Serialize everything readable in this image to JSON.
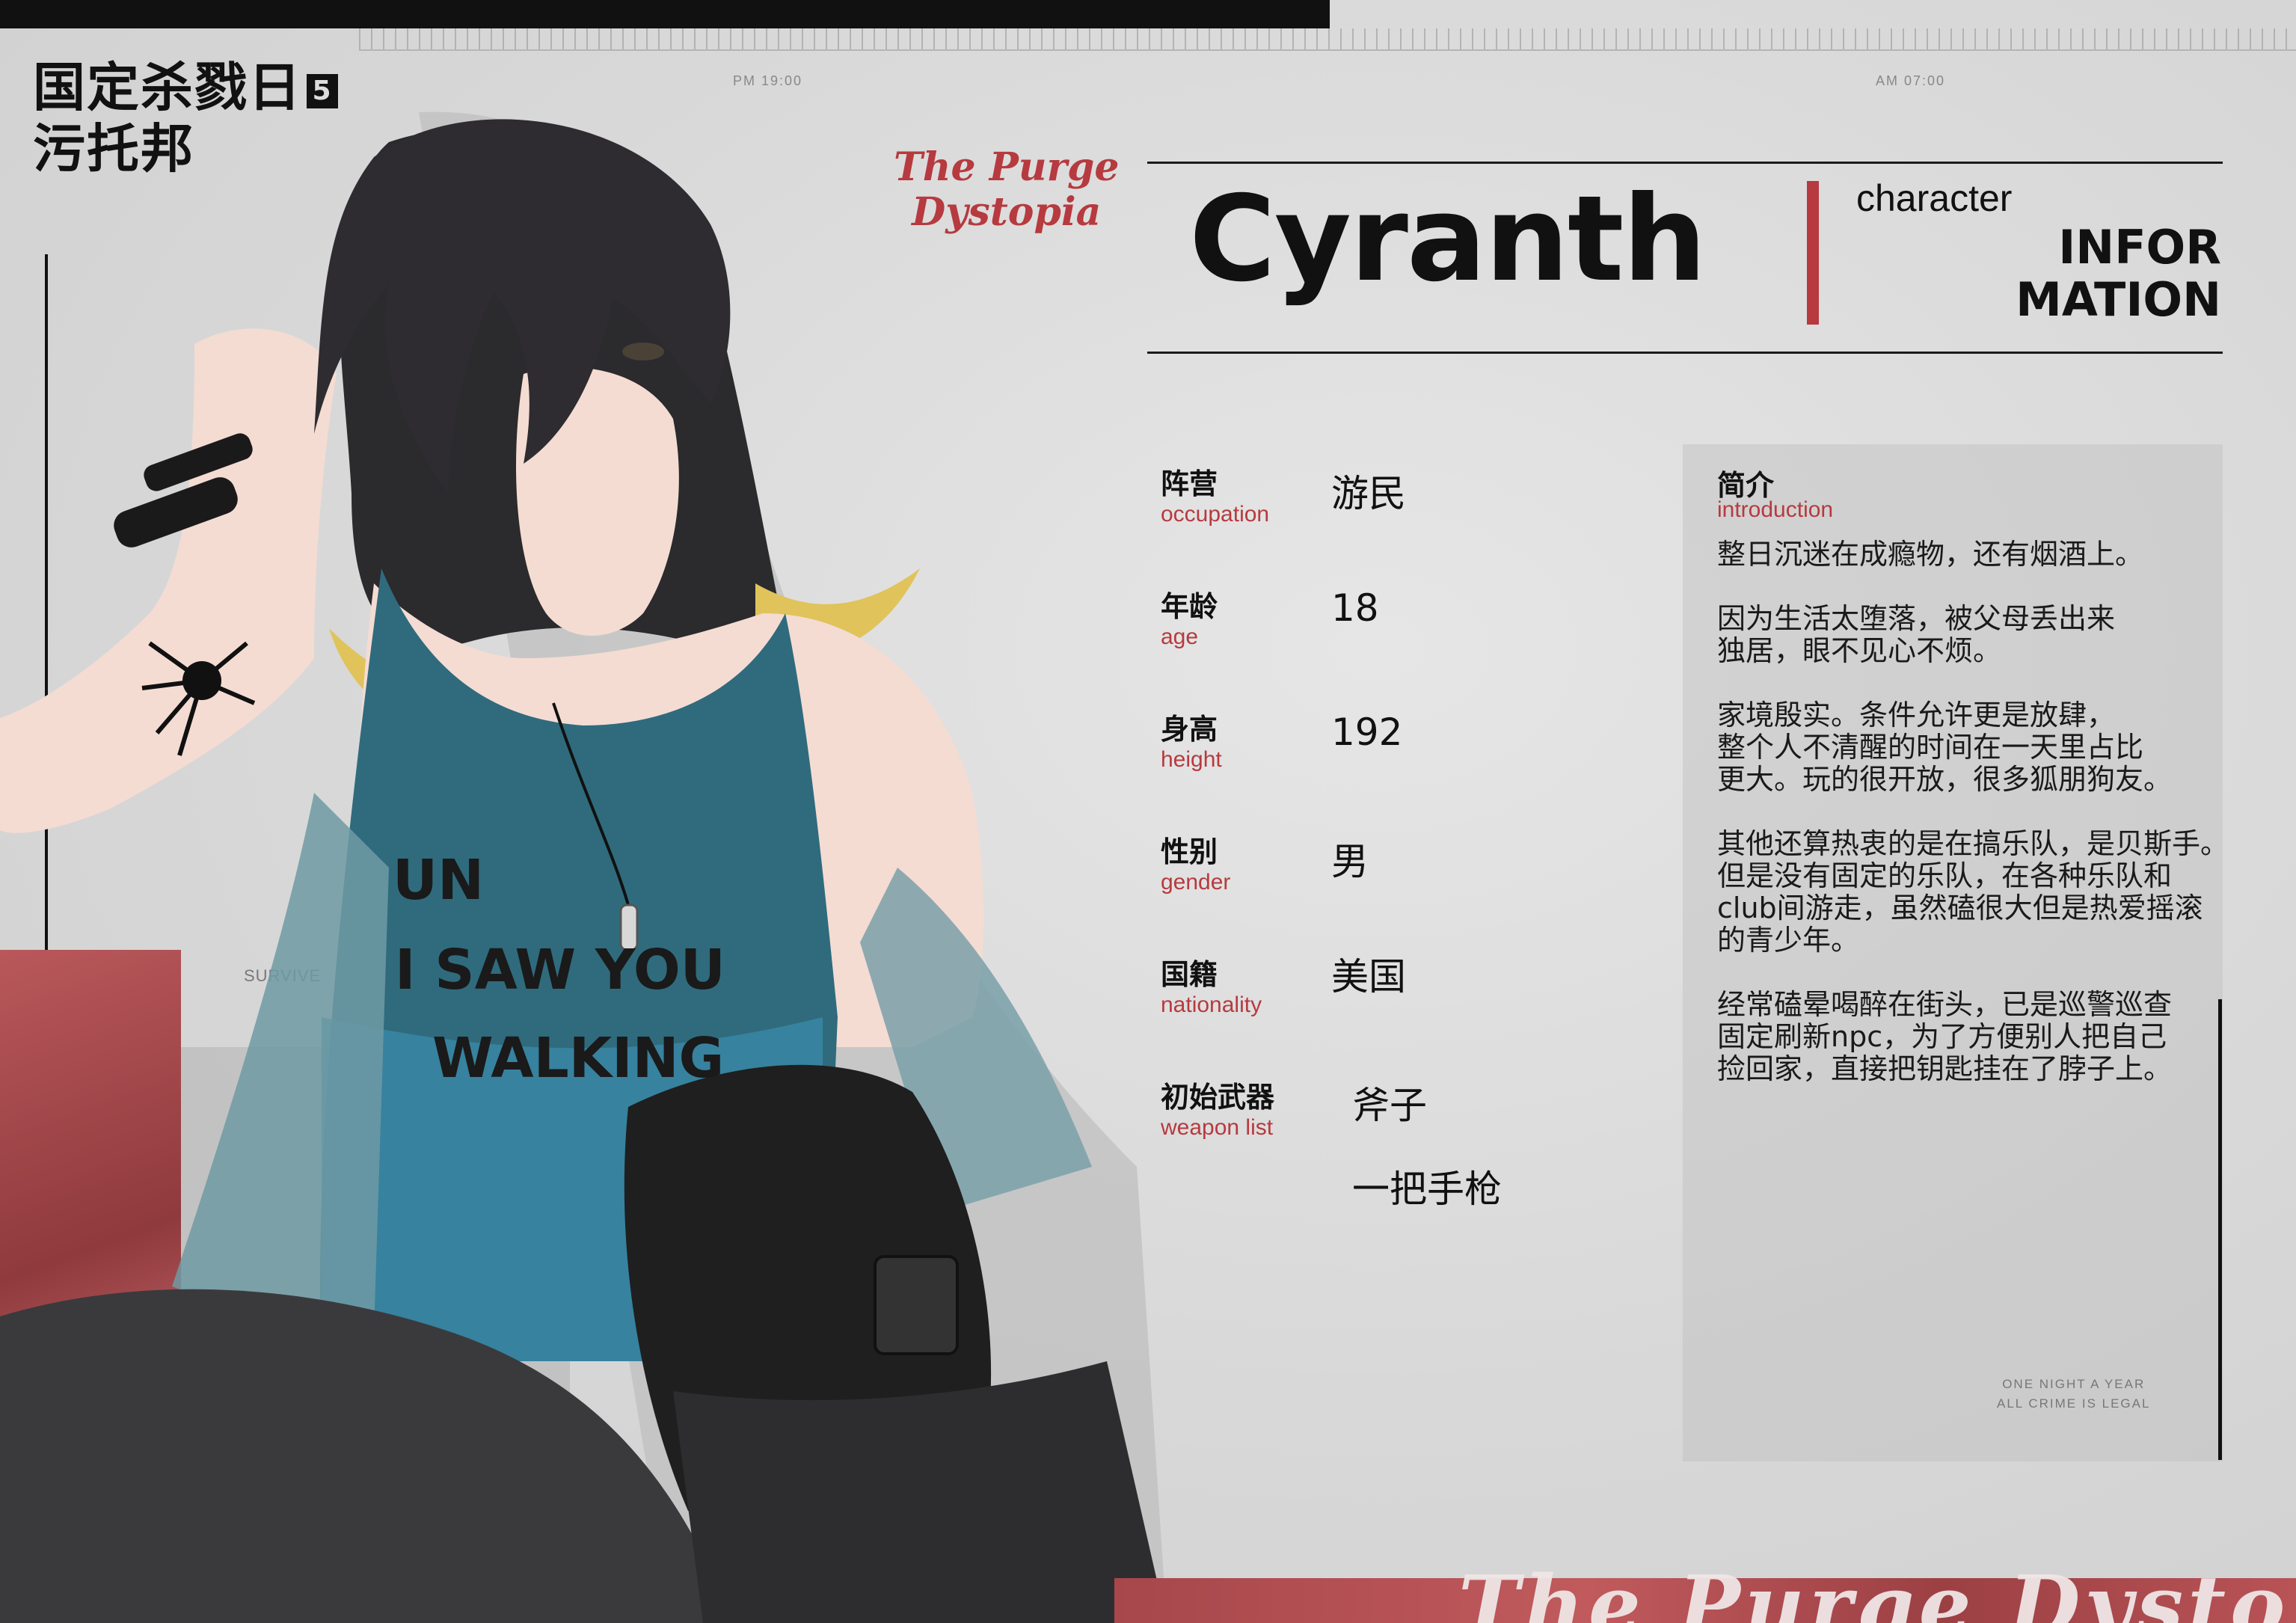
{
  "header": {
    "time_left": "PM 19:00",
    "time_right": "AM 07:00"
  },
  "logo": {
    "line1": "国定杀戮日",
    "badge": "5",
    "line2": "污托邦"
  },
  "emblem": {
    "line1": "The Purge",
    "line2": "Dystopia"
  },
  "shirt_text": {
    "line1": "UN",
    "line2": "I SAW YOU",
    "line3": "WALKING"
  },
  "survive_label": "SURVIVE",
  "title_card": {
    "name": "Cyranth",
    "subtitle_small": "character",
    "subtitle_big_1": "INFOR",
    "subtitle_big_2": "MATION"
  },
  "fields": [
    {
      "label_cn": "阵营",
      "label_en": "occupation",
      "value": "游民"
    },
    {
      "label_cn": "年龄",
      "label_en": "age",
      "value": "18"
    },
    {
      "label_cn": "身高",
      "label_en": "height",
      "value": "192"
    },
    {
      "label_cn": "性别",
      "label_en": "gender",
      "value": "男"
    },
    {
      "label_cn": "国籍",
      "label_en": "nationality",
      "value": "美国"
    },
    {
      "label_cn": "初始武器",
      "label_en": "weapon list",
      "value": "斧子",
      "value2": "一把手枪"
    }
  ],
  "intro": {
    "title_cn": "简介",
    "title_en": "introduction",
    "paragraphs": [
      "整日沉迷在成瘾物，还有烟酒上。",
      "因为生活太堕落，被父母丢出来\n独居，眼不见心不烦。",
      "家境殷实。条件允许更是放肆，\n整个人不清醒的时间在一天里占比\n更大。玩的很开放，很多狐朋狗友。",
      "其他还算热衷的是在搞乐队，是贝斯手。\n但是没有固定的乐队，在各种乐队和\nclub间游走，虽然磕很大但是热爱摇滚\n的青少年。",
      "经常磕晕喝醉在街头，已是巡警巡查\n固定刷新npc，为了方便别人把自己\n捡回家，直接把钥匙挂在了脖子上。"
    ]
  },
  "tagline": {
    "line1": "ONE NIGHT A YEAR",
    "line2": "ALL CRIME IS LEGAL"
  },
  "bottom_banner": "The Purge Dystopia",
  "colors": {
    "accent_red": "#b63a3f",
    "ink": "#111111",
    "paper": "#dcdcdc"
  }
}
